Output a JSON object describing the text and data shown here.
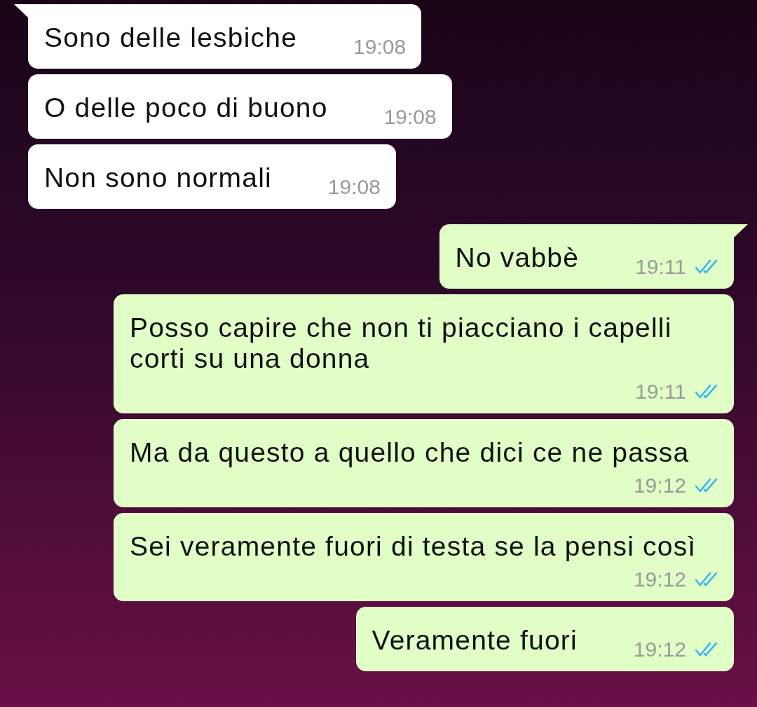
{
  "messages": [
    {
      "kind": "incoming",
      "text": "Sono delle lesbiche",
      "time": "19:08",
      "tail": true
    },
    {
      "kind": "incoming",
      "text": "O delle poco di buono",
      "time": "19:08",
      "tail": false
    },
    {
      "kind": "incoming",
      "text": "Non sono normali",
      "time": "19:08",
      "tail": false
    },
    {
      "kind": "outgoing",
      "text": "No vabbè",
      "time": "19:11",
      "tail": true,
      "read": true
    },
    {
      "kind": "outgoing",
      "text": "Posso capire che non ti piacciano i capelli corti su una donna",
      "time": "19:11",
      "tail": false,
      "read": true
    },
    {
      "kind": "outgoing",
      "text": "Ma da questo a quello che dici ce ne passa",
      "time": "19:12",
      "tail": false,
      "read": true
    },
    {
      "kind": "outgoing",
      "text": "Sei veramente fuori di testa se la pensi così",
      "time": "19:12",
      "tail": false,
      "read": true
    },
    {
      "kind": "outgoing",
      "text": "Veramente fuori",
      "time": "19:12",
      "tail": false,
      "read": true
    }
  ]
}
